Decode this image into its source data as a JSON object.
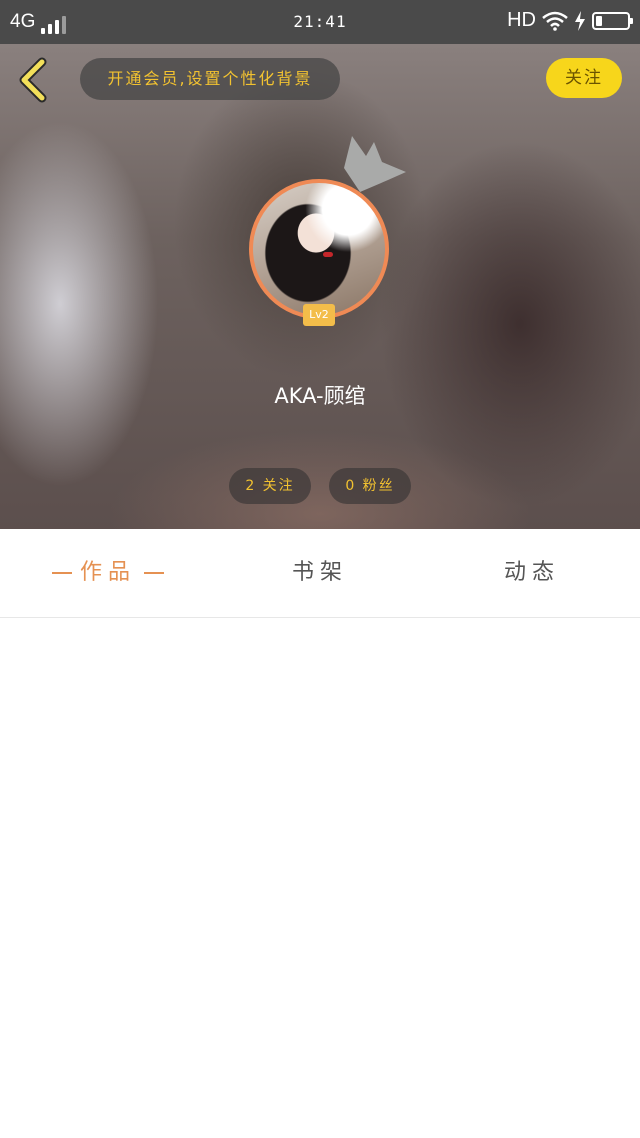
{
  "status_bar": {
    "network": "4G",
    "time": "21:41",
    "hd": "HD",
    "battery_level": 0.2
  },
  "header": {
    "vip_banner": "开通会员,设置个性化背景",
    "follow_button": "关注",
    "level": "Lv2",
    "username": "AKA-顾绾",
    "following": "2 关注",
    "fans": "0 粉丝"
  },
  "tabs": [
    {
      "label": "作品",
      "active": true
    },
    {
      "label": "书架",
      "active": false
    },
    {
      "label": "动态",
      "active": false
    }
  ],
  "colors": {
    "accent": "#e59152",
    "follow_yellow": "#f7d61b",
    "banner_text": "#f2c230"
  },
  "icons": [
    "back-chevron-icon",
    "signal-icon",
    "wifi-icon",
    "charging-icon",
    "battery-icon",
    "crown-icon"
  ]
}
